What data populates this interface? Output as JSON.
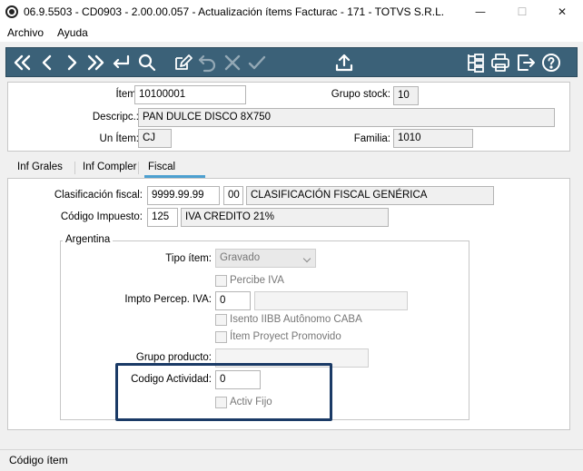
{
  "window": {
    "title": "06.9.5503 - CD0903 - 2.00.00.057 - Actualización ítems Facturac - 171 - TOTVS S.R.L.",
    "min_glyph": "—",
    "max_glyph": "☐",
    "close_glyph": "✕"
  },
  "menu": {
    "archivo": "Archivo",
    "ayuda": "Ayuda"
  },
  "toolbar": {
    "icons": [
      "first-icon",
      "previous-icon",
      "next-icon",
      "last-icon",
      "enter-icon",
      "search-icon",
      "edit-icon",
      "undo-icon",
      "cancel-icon",
      "confirm-icon",
      "export-icon",
      "tree-icon",
      "print-icon",
      "exit-icon",
      "help-icon"
    ]
  },
  "header": {
    "item_label": "Ítem:",
    "item_value": "10100001",
    "grupo_stock_label": "Grupo stock:",
    "grupo_stock_value": "10",
    "descripc_label": "Descripc.:",
    "descripc_value": "PAN DULCE DISCO 8X750",
    "un_item_label": "Un Ítem:",
    "un_item_value": "CJ",
    "familia_label": "Familia:",
    "familia_value": "1010"
  },
  "tabs": {
    "inf_grales": "Inf Grales",
    "inf_compler": "Inf Compler",
    "fiscal": "Fiscal"
  },
  "fiscal": {
    "clasificacion_label": "Clasificación fiscal:",
    "clasificacion_code": "9999.99.99",
    "clasificacion_sub": "00",
    "clasificacion_desc": "CLASIFICACIÓN FISCAL GENÉRICA",
    "codigo_impuesto_label": "Código Impuesto:",
    "codigo_impuesto_value": "125",
    "codigo_impuesto_desc": "IVA CREDITO 21%"
  },
  "argentina": {
    "group_title": "Argentina",
    "tipo_item_label": "Tipo ítem:",
    "tipo_item_value": "Gravado",
    "percibe_iva_label": "Percibe IVA",
    "impto_percep_label": "Impto Percep. IVA:",
    "impto_percep_value": "0",
    "isento_label": "Isento IIBB Autônomo CABA",
    "item_proyect_label": "Ítem Proyect Promovido",
    "grupo_producto_label": "Grupo producto:",
    "codigo_actividad_label": "Codigo Actividad:",
    "codigo_actividad_value": "0",
    "activ_fijo_label": "Activ Fijo"
  },
  "status": {
    "text": "Código ítem"
  },
  "colors": {
    "toolbar": "#3b6178",
    "tab_active": "#4ca0d0",
    "highlight": "#1a3a66"
  }
}
